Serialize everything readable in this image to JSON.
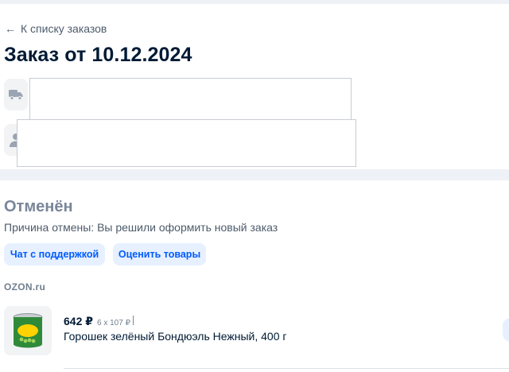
{
  "header": {
    "back_arrow_icon": "arrow-left-icon",
    "back_label": "К списку заказов",
    "order_title": "Заказ от 10.12.2024"
  },
  "info_icons": {
    "delivery_icon": "truck-icon",
    "recipient_icon": "person-icon"
  },
  "order_status": {
    "status": "Отменён",
    "reason": "Причина отмены: Вы решили оформить новый заказ"
  },
  "actions": {
    "support_label": "Чат с поддержкой",
    "rate_label": "Оценить товары"
  },
  "seller": {
    "name": "OZON.ru"
  },
  "product": {
    "price": "642 ₽",
    "quantity": "6 x 107 ₽",
    "name": "Горошек зелёный Бондюэль Нежный, 400 г",
    "brand_mark": "Bonduelle"
  },
  "colors": {
    "accent": "#005bff",
    "button_bg": "#e6f0ff",
    "status_gray": "#7a8699",
    "text_primary": "#001a34"
  }
}
